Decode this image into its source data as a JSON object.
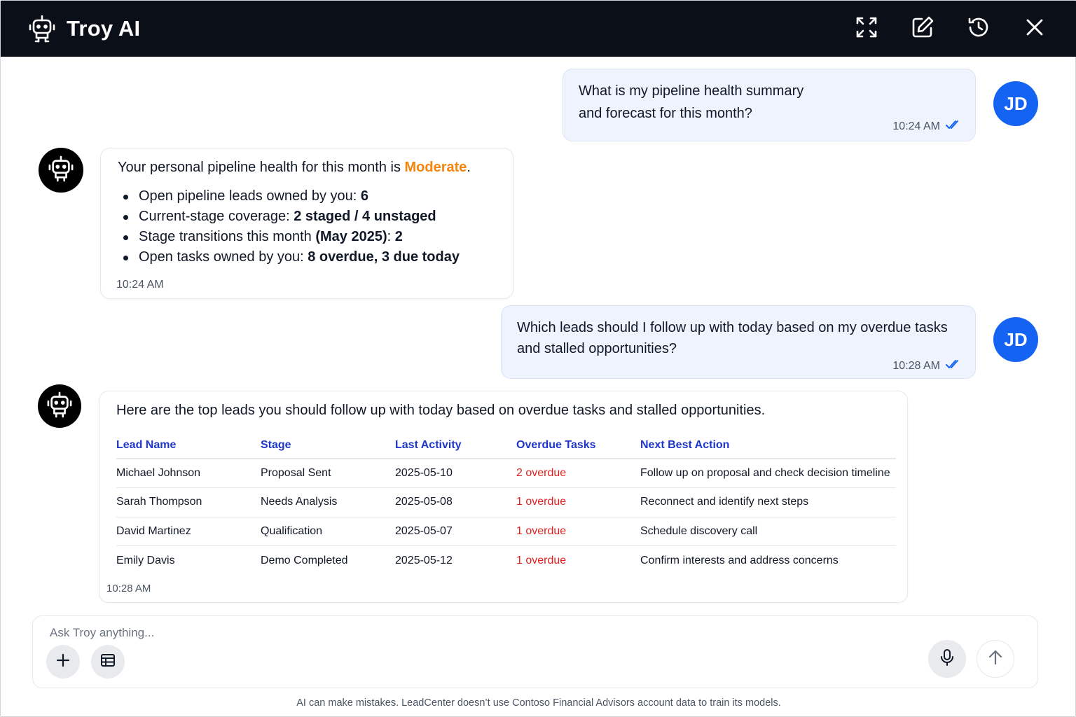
{
  "header": {
    "title": "Troy AI",
    "icons": [
      "robot-icon",
      "expand-icon",
      "edit-icon",
      "history-icon",
      "close-icon"
    ]
  },
  "messages": [
    {
      "role": "user",
      "avatar": "JD",
      "lines": [
        "What is my pipeline health summary",
        "and forecast for this month?"
      ],
      "time": "10:24 AM"
    },
    {
      "role": "bot",
      "summary_prefix": "Your personal pipeline health for this month is ",
      "status": "Moderate",
      "summary_suffix": ".",
      "bullets": [
        {
          "label": "Open pipeline leads owned by you: ",
          "value": "6"
        },
        {
          "label": "Current-stage coverage: ",
          "value": "2 staged / 4 unstaged"
        },
        {
          "label": "Stage transitions this month ",
          "value": "(May 2025)",
          "after": ": ",
          "value2": "2"
        },
        {
          "label": "Open tasks owned by you: ",
          "value": "8 overdue, 3 due today"
        }
      ],
      "time": "10:24 AM"
    },
    {
      "role": "user",
      "avatar": "JD",
      "lines": [
        "Which leads should I follow up with today based on my overdue tasks",
        "and stalled opportunities?"
      ],
      "time": "10:28 AM"
    },
    {
      "role": "bot",
      "intro": "Here are the top leads you should follow up with today based on overdue tasks and stalled opportunities.",
      "table": {
        "columns": [
          "Lead Name",
          "Stage",
          "Last Activity",
          "Overdue Tasks",
          "Next Best Action"
        ],
        "rows": [
          [
            "Michael Johnson",
            "Proposal Sent",
            "2025-05-10",
            "2 overdue",
            "Follow up on proposal and check decision timeline"
          ],
          [
            "Sarah Thompson",
            "Needs Analysis",
            "2025-05-08",
            "1 overdue",
            "Reconnect and identify next steps"
          ],
          [
            "David Martinez",
            "Qualification",
            "2025-05-07",
            "1 overdue",
            "Schedule discovery call"
          ],
          [
            "Emily Davis",
            "Demo Completed",
            "2025-05-12",
            "1 overdue",
            "Confirm interests and address concerns"
          ]
        ]
      },
      "time": "10:28 AM"
    }
  ],
  "composer": {
    "placeholder": "Ask Troy anything...",
    "value": "",
    "icons": [
      "plus-icon",
      "table-icon",
      "microphone-icon",
      "send-arrow-icon"
    ]
  },
  "disclaimer": "AI can make mistakes. LeadCenter doesn’t use Contoso Financial Advisors account data to train its models.",
  "colors": {
    "header_bg": "#0b0f17",
    "user_avatar": "#1463f3",
    "user_bubble": "#eef3fd",
    "status_moderate": "#f5850c",
    "table_header": "#1d36c9",
    "overdue": "#e11d1d",
    "read_receipt": "#1463f3"
  }
}
